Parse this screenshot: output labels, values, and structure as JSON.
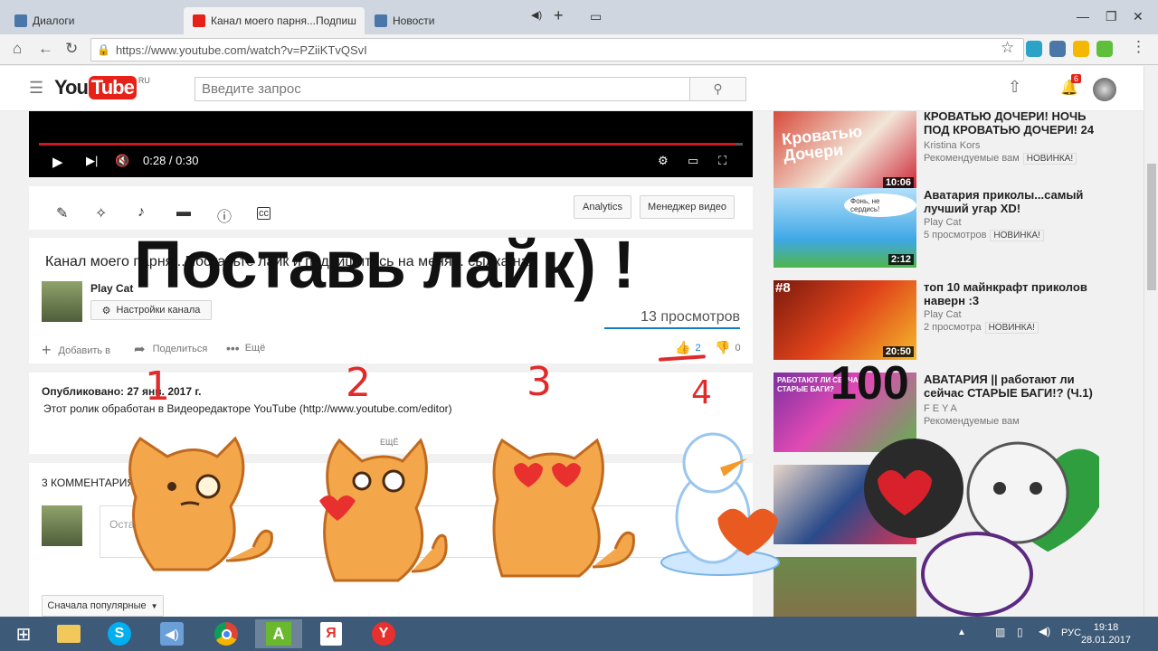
{
  "browser": {
    "tabs": [
      {
        "label": "Диалоги"
      },
      {
        "label": "Канал моего парня...Подпиши"
      },
      {
        "label": "Новости"
      }
    ],
    "url": "https://www.youtube.com/watch?v=PZiiKTvQSvI"
  },
  "masthead": {
    "logo_you": "You",
    "logo_tube": "Tube",
    "logo_region": "RU",
    "search_placeholder": "Введите запрос",
    "notification_count": "6"
  },
  "player": {
    "time": "0:28 / 0:30",
    "progress": 0.99
  },
  "editor": {
    "analytics_label": "Analytics",
    "manager_label": "Менеджер видео"
  },
  "video": {
    "title": "Канал моего парня...Поставьте лайк и подпишитесь на меня... сылка на",
    "channel": "Play Cat",
    "channel_settings": "Настройки канала",
    "views": "13 просмотров",
    "add_to": "Добавить в",
    "share": "Поделиться",
    "more": "Ещё",
    "likes": "2",
    "dislikes": "0"
  },
  "description": {
    "published": "Опубликовано: 27 янв. 2017 г.",
    "text": "Этот ролик обработан в Видеоредакторе YouTube (http://www.youtube.com/editor)",
    "more": "ЕЩЁ"
  },
  "comments": {
    "header": "3 КОММЕНТАРИЯ",
    "input_placeholder": "Оставьте комментарий",
    "sort": "Сначала популярные"
  },
  "sidebar": [
    {
      "title": "КРОВАТЬЮ ДОЧЕРИ! НОЧЬ ПОД КРОВАТЬЮ ДОЧЕРИ! 24",
      "author": "Kristina Kors",
      "meta": "Рекомендуемые вам",
      "badge": "НОВИНКА!",
      "duration": "10:06",
      "thumb_text": "Кроватью Дочери"
    },
    {
      "title": "Аватария приколы...самый лучший угар XD!",
      "author": "Play Cat",
      "meta": "5 просмотров",
      "badge": "НОВИНКА!",
      "duration": "2:12",
      "thumb_text": "Фонь, не сердись!"
    },
    {
      "title": "топ 10 майнкрафт приколов наверн :3",
      "author": "Play Cat",
      "meta": "2 просмотра",
      "badge": "НОВИНКА!",
      "duration": "20:50",
      "thumb_text": "#8"
    },
    {
      "title": "АВАТАРИЯ || работают ли сейчас СТАРЫЕ БАГИ!? (Ч.1)",
      "author": "F E Y A",
      "meta": "Рекомендуемые вам",
      "badge": "",
      "duration": "",
      "thumb_text": "РАБОТАЮТ ЛИ СЕЙЧАС СТАРЫЕ БАГИ?"
    },
    {
      "title": "",
      "author": "",
      "meta": "",
      "badge": "",
      "duration": "",
      "thumb_text": ""
    },
    {
      "title": "",
      "author": "",
      "meta": "",
      "badge": "",
      "duration": "",
      "thumb_text": ""
    }
  ],
  "overlay": {
    "headline": "Поставь лайк) !",
    "marks": [
      "1",
      "2",
      "3",
      "4"
    ],
    "big": "100"
  },
  "taskbar": {
    "lang": "РУС",
    "time": "19:18",
    "date": "28.01.2017"
  },
  "colors": {
    "yt_red": "#e62117",
    "taskbar": "#3d5a78",
    "accent_blue": "#167ac6"
  }
}
